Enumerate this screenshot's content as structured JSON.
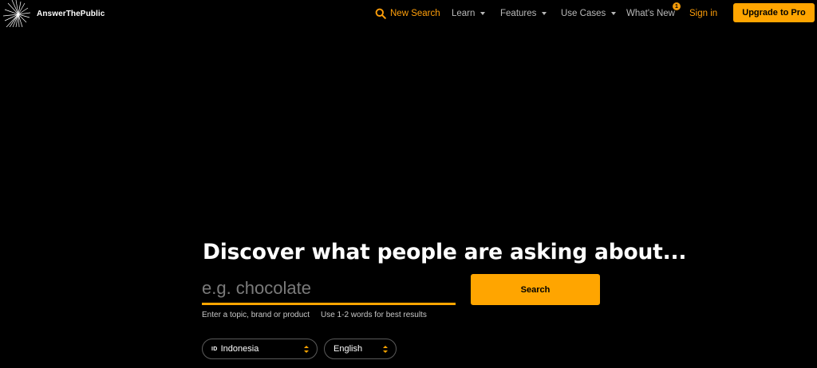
{
  "brand": {
    "name": "AnswerThePublic"
  },
  "nav": {
    "new_search": "New Search",
    "learn": "Learn",
    "features": "Features",
    "use_cases": "Use Cases",
    "whats_new": "What's New",
    "whats_new_badge": "1",
    "sign_in": "Sign in",
    "upgrade": "Upgrade to Pro"
  },
  "hero": {
    "headline": "Discover what people are asking about...",
    "search_placeholder": "e.g. chocolate",
    "search_value": "",
    "search_button": "Search",
    "hint_topic": "Enter a topic, brand or product",
    "hint_words": "Use 1-2 words for best results"
  },
  "selects": {
    "country_code": "ID",
    "country": "Indonesia",
    "language": "English"
  },
  "colors": {
    "background": "#000000",
    "accent": "#ffa500",
    "nav_text": "#b9b9b9"
  }
}
